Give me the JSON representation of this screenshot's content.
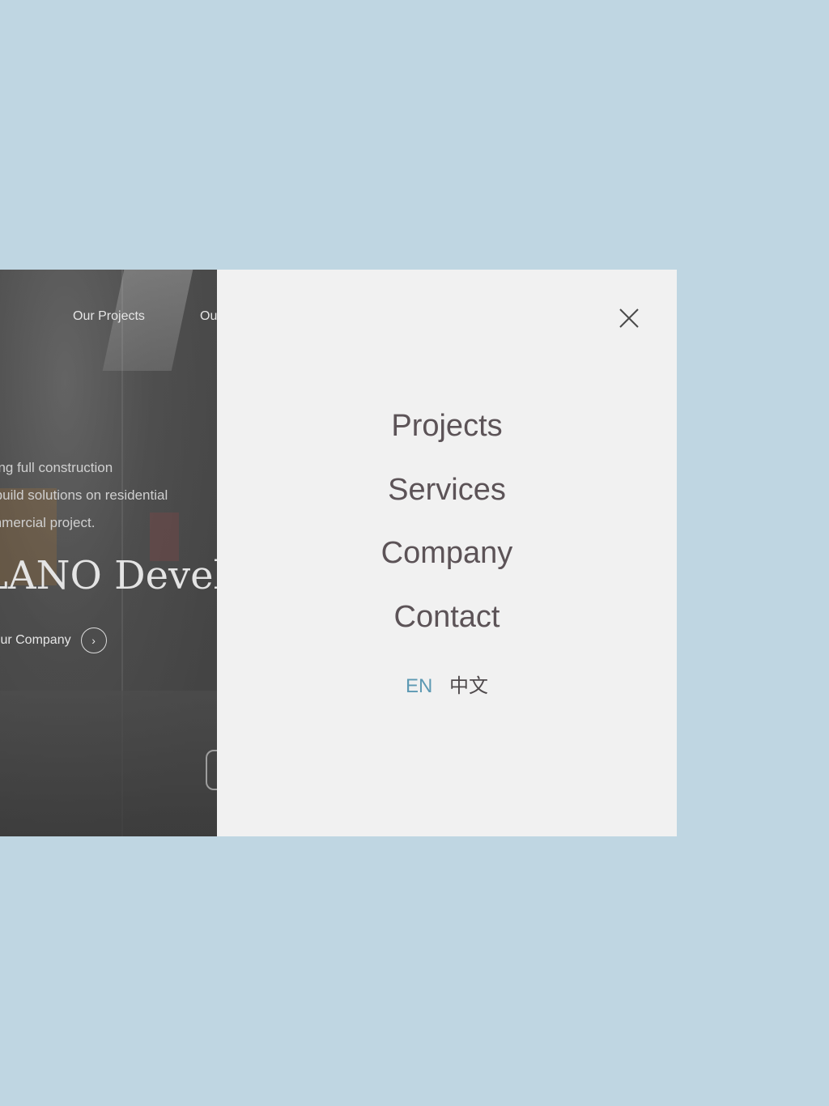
{
  "background_site": {
    "nav": [
      "Our Projects",
      "Ou"
    ],
    "description_lines": [
      "ring full construction",
      "-build solutions on residential",
      "mmercial project."
    ],
    "title": "LANO Develo",
    "cta_label": "Our Company",
    "cta_icon": "chevron-right-icon"
  },
  "menu": {
    "close_icon": "close-icon",
    "items": [
      "Projects",
      "Services",
      "Company",
      "Contact"
    ],
    "languages": [
      {
        "label": "EN",
        "active": true
      },
      {
        "label": "中文",
        "active": false
      }
    ]
  },
  "colors": {
    "page_background": "#bfd6e2",
    "menu_background": "#f1f1f1",
    "menu_text": "#5c5357",
    "accent": "#5d99b3"
  }
}
